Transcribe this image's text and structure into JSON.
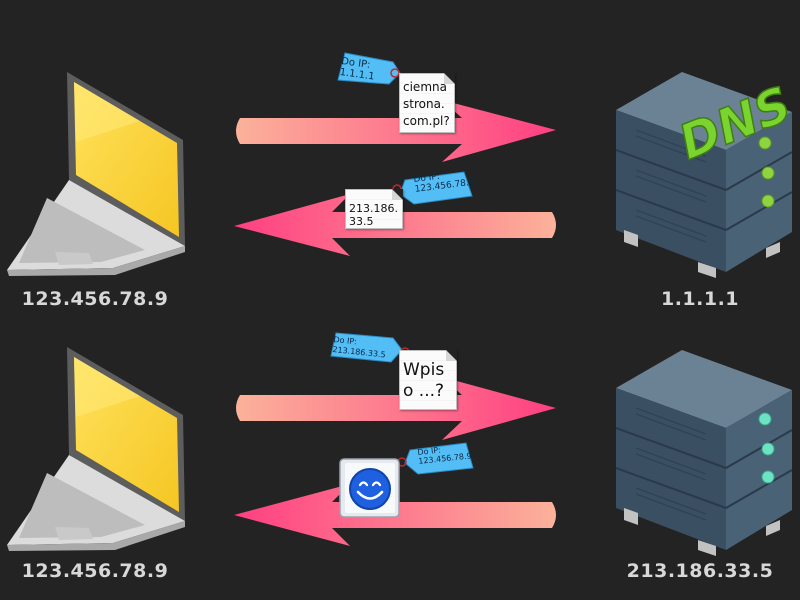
{
  "rows": [
    {
      "client_ip": "123.456.78.9",
      "server_ip": "1.1.1.1",
      "server_logo": "DNS",
      "request": {
        "tag": "Do IP:\n1.1.1.1",
        "doc": "ciemna\nstrona.\ncom.pl?"
      },
      "response": {
        "tag": "Do IP:\n123.456.78.9",
        "doc": "213.186.\n33.5"
      }
    },
    {
      "client_ip": "123.456.78.9",
      "server_ip": "213.186.33.5",
      "request": {
        "tag": "Do IP:\n213.186.33.5",
        "doc": "Wpis\no ...?"
      },
      "response": {
        "tag": "Do IP:\n123.456.78.9",
        "icon": "smiley-icon"
      }
    }
  ],
  "colors": {
    "background": "#232323",
    "arrow_light": "#fbb29a",
    "arrow_dark": "#ff3f82",
    "laptop_screen": "#ffd83a",
    "server_body": "#3d5266",
    "dns_text": "#7ad32e",
    "led_green": "#8ed43f",
    "led_teal": "#6ee3c4",
    "tag_blue": "#53bdf5",
    "smiley_blue": "#1e60e0"
  }
}
